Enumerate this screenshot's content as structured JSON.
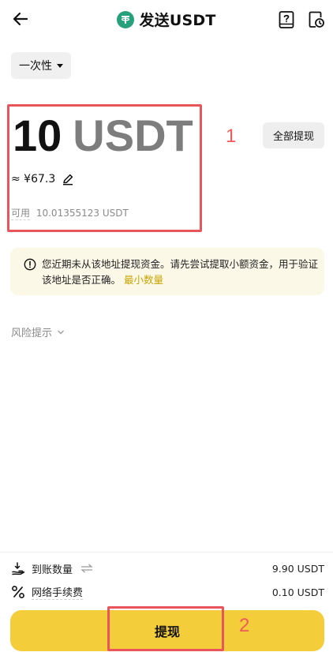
{
  "header": {
    "title": "发送USDT",
    "back_icon": "arrow-left-icon",
    "coin_icon": "tether-icon",
    "help_icon": "question-book-icon",
    "history_icon": "history-clock-icon"
  },
  "mode_select": {
    "label": "一次性"
  },
  "amount": {
    "value": "10",
    "unit": "USDT",
    "fiat": "≈ ¥67.3",
    "available_label": "可用",
    "available_value": "10.01355123 USDT",
    "max_label": "全部提现"
  },
  "warning": {
    "text": "您近期未从该地址提现资金。请先尝试提取小额资金，用于验证该地址是否正确。",
    "link": "最小数量"
  },
  "risk": {
    "label": "风险提示"
  },
  "summary": {
    "receive_label": "到账数量",
    "receive_value": "9.90 USDT",
    "fee_label": "网络手续费",
    "fee_value": "0.10 USDT"
  },
  "submit": {
    "label": "提现"
  },
  "annotations": {
    "first": "1",
    "second": "2"
  },
  "colors": {
    "accent": "#f4cd3b",
    "annotation": "#e8565b",
    "warning_bg": "#fbf8e8",
    "link": "#c9a400",
    "tether": "#26a17b"
  }
}
